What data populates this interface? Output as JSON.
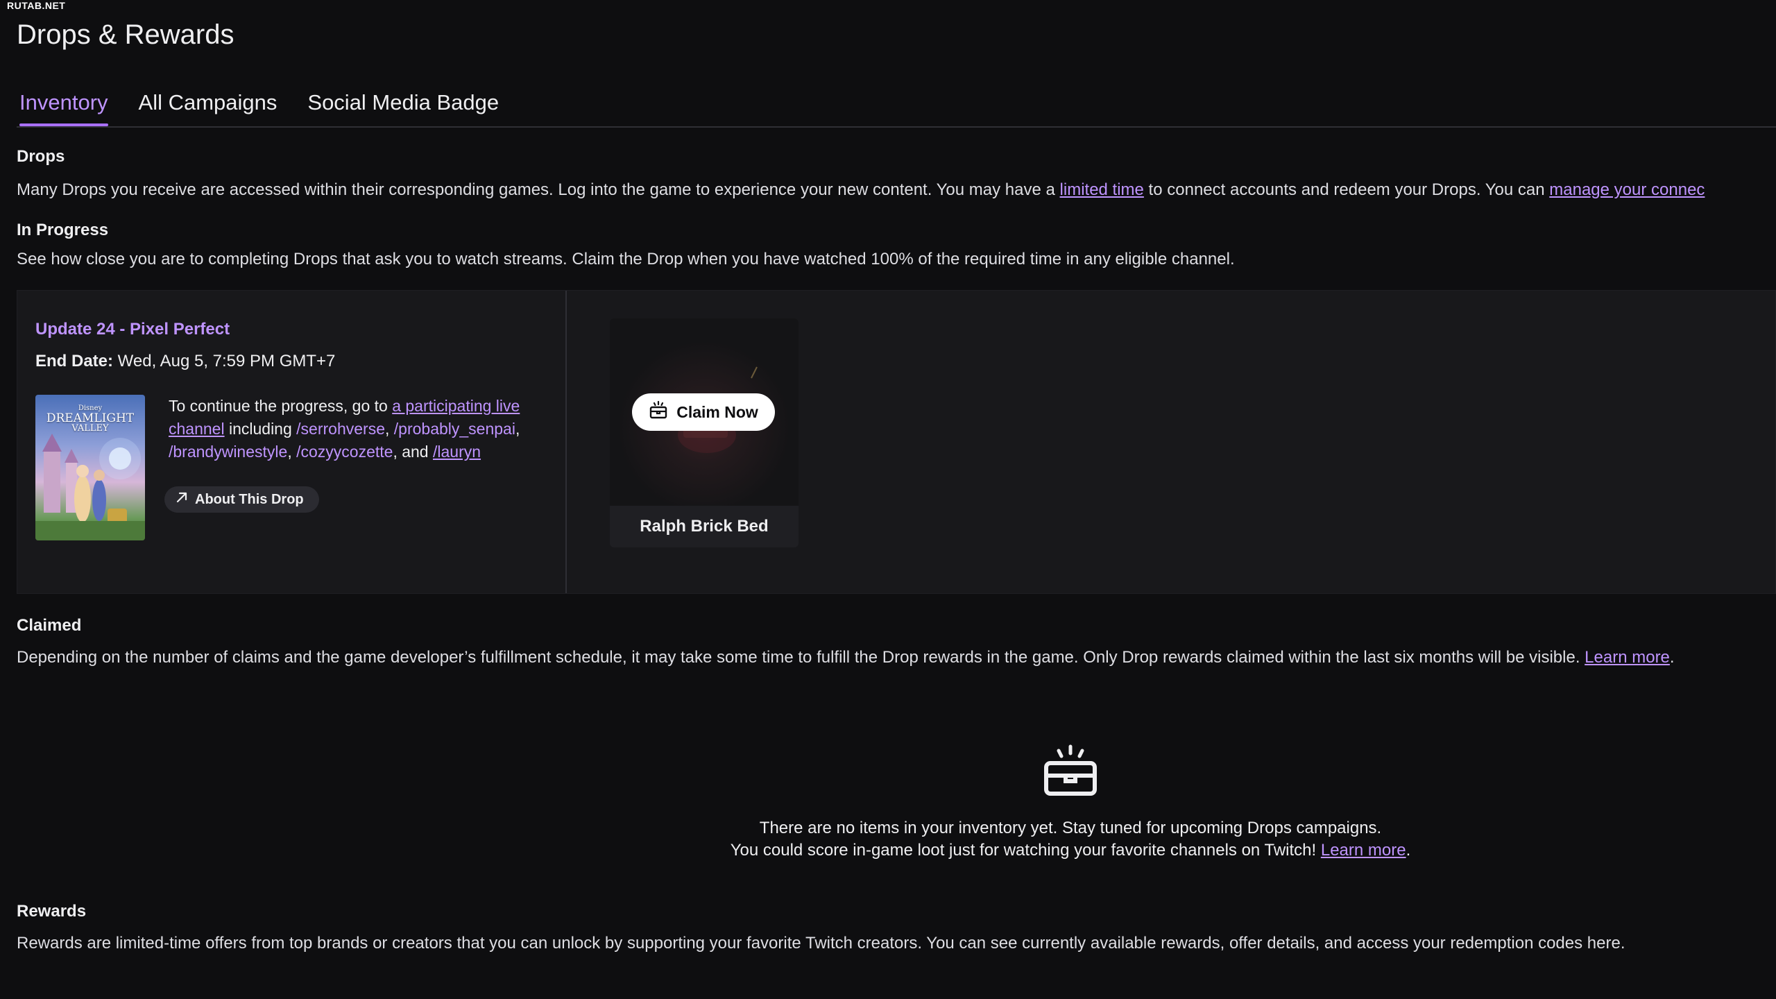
{
  "watermark": "RUTAB.NET",
  "page_title": "Drops & Rewards",
  "tabs": [
    {
      "label": "Inventory",
      "active": true
    },
    {
      "label": "All Campaigns",
      "active": false
    },
    {
      "label": "Social Media Badge",
      "active": false
    }
  ],
  "drops": {
    "heading": "Drops",
    "text_1": "Many Drops you receive are accessed within their corresponding games. Log into the game to experience your new content. You may have a ",
    "link_1": "limited time",
    "text_2": " to connect accounts and redeem your Drops. You can ",
    "link_2": "manage your connec"
  },
  "in_progress": {
    "heading": "In Progress",
    "text": "See how close you are to completing Drops that ask you to watch streams. Claim the Drop when you have watched 100% of the required time in any eligible channel."
  },
  "campaign": {
    "title": "Update 24 - Pixel Perfect",
    "end_date_label": "End Date:",
    "end_date_value": " Wed, Aug 5, 7:59 PM GMT+7",
    "game_logo_small": "Disney",
    "game_logo_line1": "DREAMLIGHT",
    "game_logo_line2": "VALLEY",
    "progress_intro": "To continue the progress, go to ",
    "progress_link": "a participating live channel",
    "progress_including": " including ",
    "channels": [
      "/serrohverse",
      "/probably_senpai",
      "/brandywinestyle",
      "/cozyycozette"
    ],
    "progress_and": ", and ",
    "last_channel": "/lauryn",
    "about_label": "About This Drop"
  },
  "reward": {
    "name": "Ralph Brick Bed",
    "claim_label": "Claim Now"
  },
  "claimed": {
    "heading": "Claimed",
    "text": "Depending on the number of claims and the game developer’s fulfillment schedule, it may take some time to fulfill the Drop rewards in the game. Only Drop rewards claimed within the last six months will be visible. ",
    "link": "Learn more",
    "suffix": "."
  },
  "empty": {
    "line1": "There are no items in your inventory yet. Stay tuned for upcoming Drops campaigns.",
    "line2": "You could score in-game loot just for watching your favorite channels on Twitch! ",
    "link": "Learn more",
    "suffix": "."
  },
  "rewards": {
    "heading": "Rewards",
    "text": "Rewards are limited-time offers from top brands or creators that you can unlock by supporting your favorite Twitch creators. You can see currently available rewards, offer details, and access your redemption codes here."
  },
  "colors": {
    "background": "#0e0e10",
    "accent": "#bf94ff",
    "card": "#18181b"
  },
  "icons": [
    "drop-box-icon",
    "arrow-up-right-icon"
  ]
}
